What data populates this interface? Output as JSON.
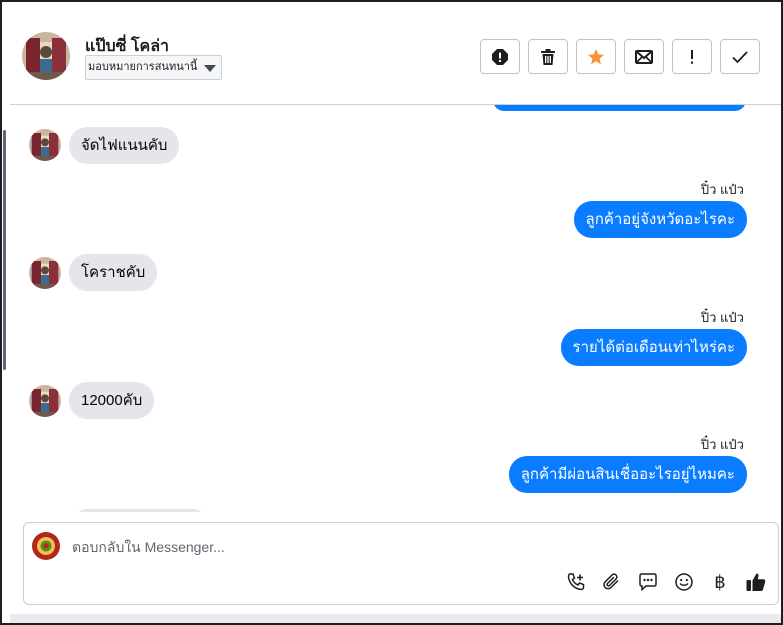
{
  "header": {
    "contact_name": "แป๊บซี่ โคล่า",
    "assign_label": "มอบหมายการสนทนานี้"
  },
  "toolbar": {
    "buttons": [
      {
        "name": "mark-spam",
        "icon": "alert-circle-icon"
      },
      {
        "name": "delete",
        "icon": "trash-icon"
      },
      {
        "name": "star",
        "icon": "star-icon"
      },
      {
        "name": "mark-unread",
        "icon": "envelope-icon"
      },
      {
        "name": "important",
        "icon": "exclamation-icon"
      },
      {
        "name": "done",
        "icon": "checkmark-icon"
      }
    ]
  },
  "messages": [
    {
      "direction": "in",
      "text": "จัดไฟแนนคับ"
    },
    {
      "direction": "out",
      "sender": "ปิ๋ว แป๋ว",
      "text": "ลูกค้าอยู่จังหวัดอะไรคะ"
    },
    {
      "direction": "in",
      "text": "โคราชคับ"
    },
    {
      "direction": "out",
      "sender": "ปิ๋ว แป๋ว",
      "text": "รายได้ต่อเดือนเท่าไหร่คะ"
    },
    {
      "direction": "in",
      "text": "12000คับ"
    },
    {
      "direction": "out",
      "sender": "ปิ๋ว แป๋ว",
      "text": "ลูกค้ามีผ่อนสินเชื่ออะไรอยู่ไหมคะ"
    }
  ],
  "composer": {
    "placeholder": "ตอบกลับใน Messenger...",
    "tools": [
      "call-add-icon",
      "paperclip-icon",
      "saved-reply-icon",
      "emoji-icon",
      "baht-icon",
      "thumbs-up-icon"
    ],
    "baht_symbol": "฿"
  },
  "colors": {
    "outgoing_bubble": "#0a7cff",
    "incoming_bubble": "#e4e6eb",
    "star_accent": "#f7923a"
  }
}
